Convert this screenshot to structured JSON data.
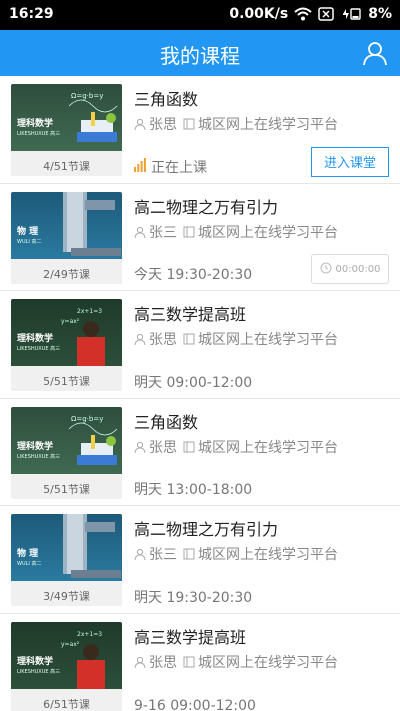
{
  "status_bar": {
    "time": "16:29",
    "speed": "0.00K/s",
    "battery": "8%"
  },
  "header": {
    "title": "我的课程"
  },
  "icons": {
    "user": "user-icon",
    "teacher": "person-icon",
    "platform": "book-icon",
    "live": "signal-icon",
    "timer": "clock-icon"
  },
  "colors": {
    "accent": "#2196f3",
    "live": "#f0a030"
  },
  "courses": [
    {
      "name": "三角函数",
      "teacher": "张思",
      "platform": "城区网上在线学习平台",
      "lessons": "4/51节课",
      "subject": "理科数学",
      "subtitle": "LIKESHUXUE 高三",
      "status": "正在上课",
      "action": "进入课堂",
      "art": "math"
    },
    {
      "name": "高二物理之万有引力",
      "teacher": "张三",
      "platform": "城区网上在线学习平台",
      "lessons": "2/49节课",
      "subject": "物 理",
      "subtitle": "WULI 高二",
      "time": "今天 19:30-20:30",
      "countdown": "00:00:00",
      "art": "physics"
    },
    {
      "name": "高三数学提高班",
      "teacher": "张思",
      "platform": "城区网上在线学习平台",
      "lessons": "5/51节课",
      "subject": "理科数学",
      "subtitle": "LIKESHUXUE 高三",
      "time": "明天 09:00-12:00",
      "art": "board"
    },
    {
      "name": "三角函数",
      "teacher": "张思",
      "platform": "城区网上在线学习平台",
      "lessons": "5/51节课",
      "subject": "理科数学",
      "subtitle": "LIKESHUXUE 高三",
      "time": "明天 13:00-18:00",
      "art": "math"
    },
    {
      "name": "高二物理之万有引力",
      "teacher": "张三",
      "platform": "城区网上在线学习平台",
      "lessons": "3/49节课",
      "subject": "物 理",
      "subtitle": "WULI 高二",
      "time": "明天 19:30-20:30",
      "art": "physics"
    },
    {
      "name": "高三数学提高班",
      "teacher": "张思",
      "platform": "城区网上在线学习平台",
      "lessons": "6/51节课",
      "subject": "理科数学",
      "subtitle": "LIKESHUXUE 高三",
      "time": "9-16 09:00-12:00",
      "art": "board"
    }
  ]
}
